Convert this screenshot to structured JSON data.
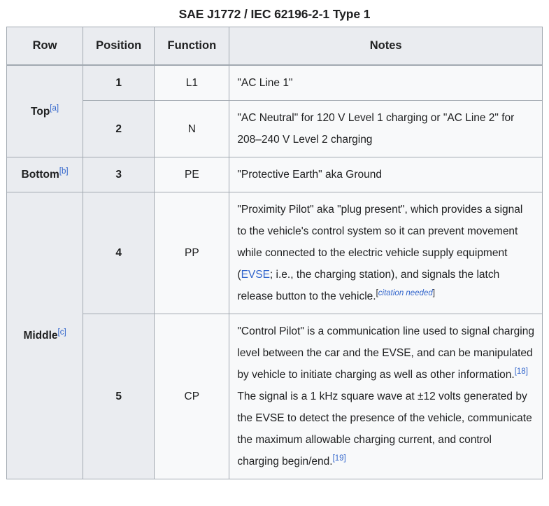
{
  "caption": "SAE J1772 / IEC 62196-2-1 Type 1",
  "colors": {
    "header_bg": "#eaecf0",
    "cell_bg": "#f8f9fa",
    "border": "#a2a9b1",
    "link": "#3366cc",
    "text": "#202122"
  },
  "table": {
    "headers": {
      "row": "Row",
      "position": "Position",
      "function": "Function",
      "notes": "Notes"
    },
    "groups": [
      {
        "label": "Top",
        "footnote": "[a]",
        "rows": [
          {
            "position": "1",
            "function": "L1",
            "notes": "\"AC Line 1\""
          },
          {
            "position": "2",
            "function": "N",
            "notes": "\"AC Neutral\" for 120 V Level 1 charging or \"AC Line 2\" for 208–240 V Level 2 charging"
          }
        ]
      },
      {
        "label": "Bottom",
        "footnote": "[b]",
        "rows": [
          {
            "position": "3",
            "function": "PE",
            "notes": "\"Protective Earth\" aka Ground"
          }
        ]
      },
      {
        "label": "Middle",
        "footnote": "[c]",
        "rows": [
          {
            "position": "4",
            "function": "PP",
            "notes_parts": {
              "before_link": "\"Proximity Pilot\" aka \"plug present\", which provides a signal to the vehicle's control system so it can prevent movement while connected to the electric vehicle supply equipment (",
              "link": "EVSE",
              "after_link": "; i.e., the charging station), and signals the latch release button to the vehicle.",
              "citation_needed": "citation needed"
            }
          },
          {
            "position": "5",
            "function": "CP",
            "notes_parts": {
              "paragraph1": "\"Control Pilot\" is a communication line used to signal charging level between the car and the EVSE, and can be manipulated by vehicle to initiate charging as well as other information.",
              "ref1": "[18]",
              "paragraph2": "The signal is a 1 kHz square wave at ±12 volts generated by the EVSE to detect the presence of the vehicle, communicate the maximum allowable charging current, and control charging begin/end.",
              "ref2": "[19]"
            }
          }
        ]
      }
    ]
  }
}
